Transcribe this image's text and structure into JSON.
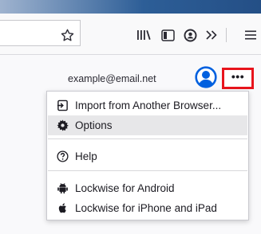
{
  "toolbar": {
    "icons": [
      "star-icon",
      "library-icon",
      "sidebar-icon",
      "account-icon",
      "overflow-chevron-icon",
      "hamburger-menu-icon"
    ]
  },
  "account": {
    "email": "example@email.net"
  },
  "more_button": {
    "label": "•••"
  },
  "menu": {
    "items": [
      {
        "label": "Import from Another Browser...",
        "icon": "import-icon"
      },
      {
        "label": "Options",
        "icon": "gear-icon",
        "highlighted": true
      },
      {
        "label": "Help",
        "icon": "help-icon"
      },
      {
        "label": "Lockwise for Android",
        "icon": "android-icon"
      },
      {
        "label": "Lockwise for iPhone and iPad",
        "icon": "apple-icon"
      }
    ]
  },
  "colors": {
    "highlight_border": "#e8141c",
    "avatar_blue": "#0060df"
  }
}
